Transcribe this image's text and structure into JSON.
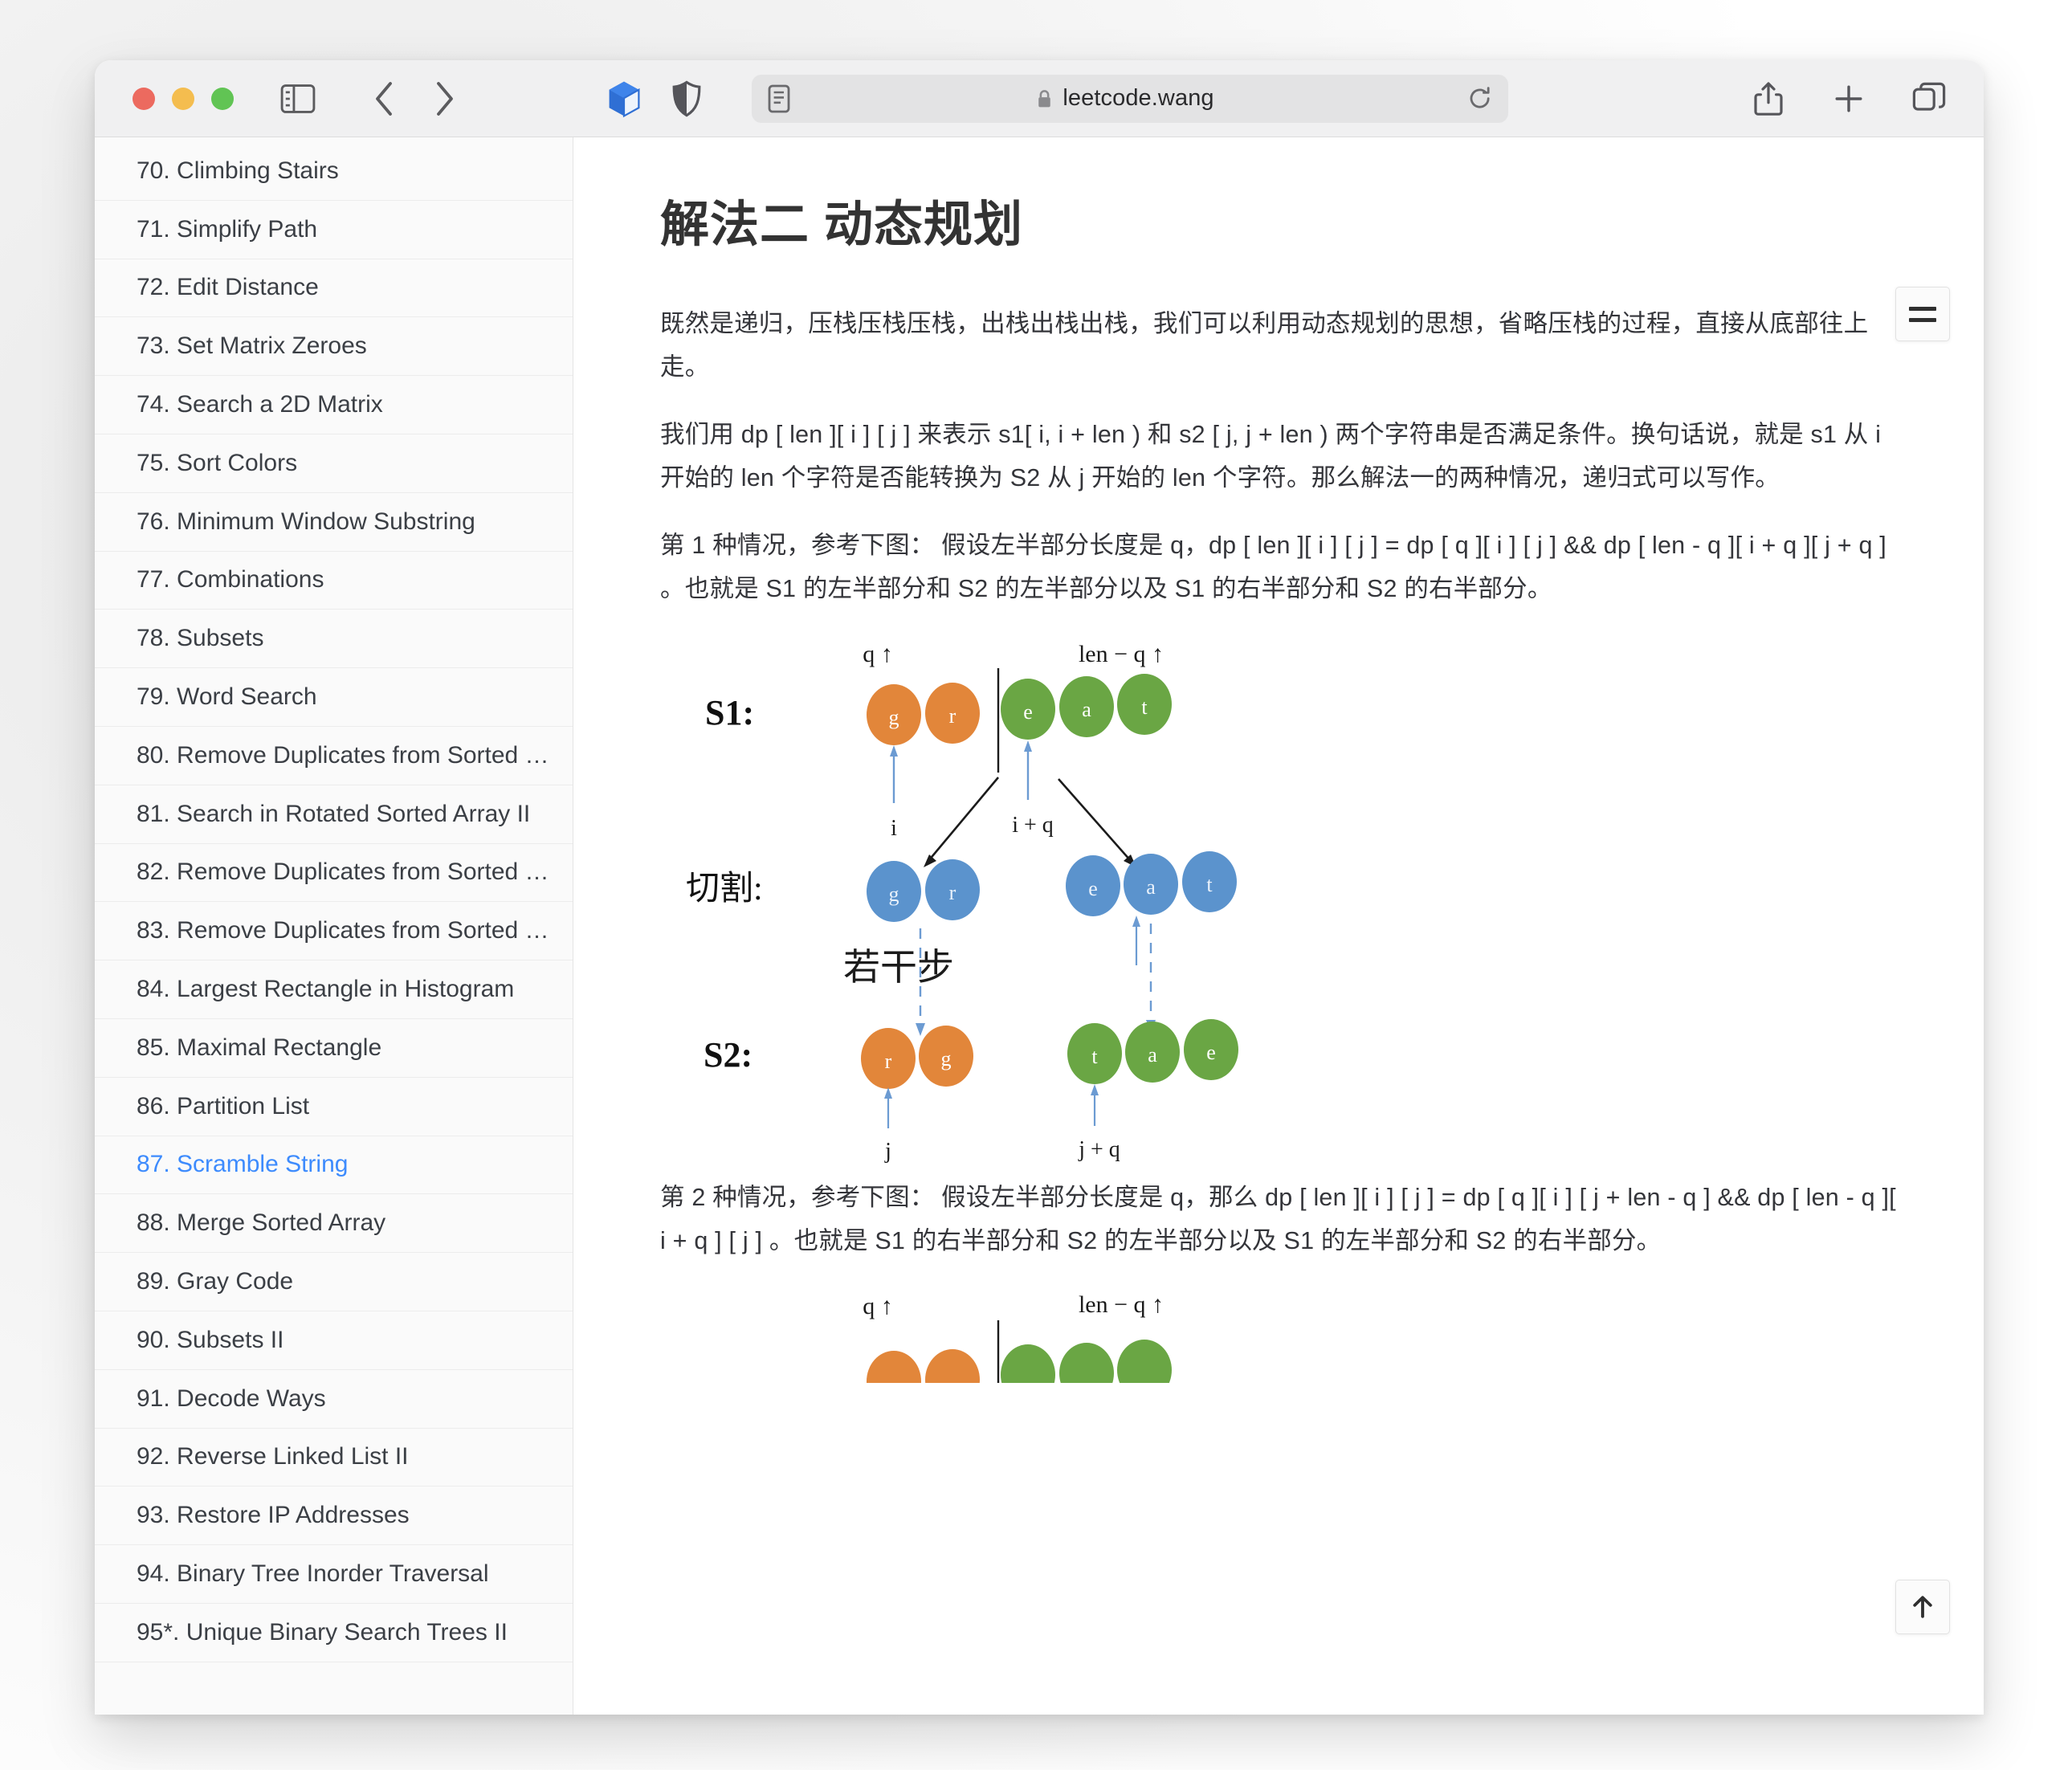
{
  "browser": {
    "url": "leetcode.wang",
    "icons": {
      "sidebar_toggle": "sidebar-icon",
      "back": "chevron-left-icon",
      "forward": "chevron-right-icon",
      "extension": "cube-icon",
      "shield": "shield-icon",
      "reader": "reader-view-icon",
      "lock": "lock-icon",
      "reload": "reload-icon",
      "share": "share-icon",
      "new_tab": "plus-icon",
      "tab_overview": "tab-overview-icon"
    }
  },
  "sidebar": {
    "items": [
      {
        "label": "70. Climbing Stairs",
        "active": false
      },
      {
        "label": "71. Simplify Path",
        "active": false
      },
      {
        "label": "72. Edit Distance",
        "active": false
      },
      {
        "label": "73. Set Matrix Zeroes",
        "active": false
      },
      {
        "label": "74. Search a 2D Matrix",
        "active": false
      },
      {
        "label": "75. Sort Colors",
        "active": false
      },
      {
        "label": "76. Minimum Window Substring",
        "active": false
      },
      {
        "label": "77. Combinations",
        "active": false
      },
      {
        "label": "78. Subsets",
        "active": false
      },
      {
        "label": "79. Word Search",
        "active": false
      },
      {
        "label": "80. Remove Duplicates from Sorted …",
        "active": false
      },
      {
        "label": "81. Search in Rotated Sorted Array II",
        "active": false
      },
      {
        "label": "82. Remove Duplicates from Sorted …",
        "active": false
      },
      {
        "label": "83. Remove Duplicates from Sorted …",
        "active": false
      },
      {
        "label": "84. Largest Rectangle in Histogram",
        "active": false
      },
      {
        "label": "85. Maximal Rectangle",
        "active": false
      },
      {
        "label": "86. Partition List",
        "active": false
      },
      {
        "label": "87. Scramble String",
        "active": true
      },
      {
        "label": "88. Merge Sorted Array",
        "active": false
      },
      {
        "label": "89. Gray Code",
        "active": false
      },
      {
        "label": "90. Subsets II",
        "active": false
      },
      {
        "label": "91. Decode Ways",
        "active": false
      },
      {
        "label": "92. Reverse Linked List II",
        "active": false
      },
      {
        "label": "93. Restore IP Addresses",
        "active": false
      },
      {
        "label": "94. Binary Tree Inorder Traversal",
        "active": false
      },
      {
        "label": "95*. Unique Binary Search Trees II",
        "active": false
      }
    ],
    "active_color": "#3d8bfd"
  },
  "article": {
    "title": "解法二 动态规划",
    "paragraphs": [
      "既然是递归，压栈压栈压栈，出栈出栈出栈，我们可以利用动态规划的思想，省略压栈的过程，直接从底部往上走。",
      "我们用 dp [ len ][ i ] [ j ] 来表示 s1[ i, i + len ) 和 s2 [ j, j + len ) 两个字符串是否满足条件。换句话说，就是 s1 从 i 开始的 len 个字符是否能转换为 S2 从 j 开始的 len 个字符。那么解法一的两种情况，递归式可以写作。",
      "第 1 种情况，参考下图： 假设左半部分长度是 q，dp [ len ][ i ] [ j ] = dp [ q ][ i ] [ j ] && dp [ len - q ][ i + q ][ j + q ] 。也就是 S1 的左半部分和 S2 的左半部分以及 S1 的右半部分和 S2 的右半部分。",
      "第 2 种情况，参考下图： 假设左半部分长度是 q，那么 dp [ len ][ i ] [ j ] = dp [ q ][ i ] [ j + len - q ] && dp [ len - q ][ i + q ] [ j ] 。也就是 S1 的右半部分和 S2 的左半部分以及 S1 的左半部分和 S2 的右半部分。"
    ]
  },
  "figure1": {
    "row_labels": {
      "s1": "S1:",
      "cut": "切割:",
      "s2": "S2:"
    },
    "top_labels": {
      "left": "q ↑",
      "right": "len − q ↑"
    },
    "index_labels": {
      "i": "i",
      "i_plus_q": "i + q",
      "j": "j",
      "j_plus_q": "j + q"
    },
    "steps_label": "若干步",
    "rows": {
      "s1": [
        {
          "letter": "g",
          "color": "#e2863a"
        },
        {
          "letter": "r",
          "color": "#e2863a"
        },
        {
          "letter": "e",
          "color": "#6aa644"
        },
        {
          "letter": "a",
          "color": "#6aa644"
        },
        {
          "letter": "t",
          "color": "#6aa644"
        }
      ],
      "cut": [
        {
          "letter": "g",
          "color": "#5b93cd"
        },
        {
          "letter": "r",
          "color": "#5b93cd"
        },
        {
          "letter": "e",
          "color": "#5b93cd"
        },
        {
          "letter": "a",
          "color": "#5b93cd"
        },
        {
          "letter": "t",
          "color": "#5b93cd"
        }
      ],
      "s2": [
        {
          "letter": "r",
          "color": "#e2863a"
        },
        {
          "letter": "g",
          "color": "#e2863a"
        },
        {
          "letter": "t",
          "color": "#6aa644"
        },
        {
          "letter": "a",
          "color": "#6aa644"
        },
        {
          "letter": "e",
          "color": "#6aa644"
        }
      ]
    }
  },
  "figure2": {
    "top_labels": {
      "left": "q ↑",
      "right": "len − q ↑"
    },
    "row": [
      {
        "letter": "",
        "color": "#e2863a"
      },
      {
        "letter": "",
        "color": "#e2863a"
      },
      {
        "letter": "",
        "color": "#6aa644"
      },
      {
        "letter": "",
        "color": "#6aa644"
      },
      {
        "letter": "",
        "color": "#6aa644"
      }
    ]
  },
  "buttons": {
    "toc": "toc-hamburger",
    "back_to_top": "back-to-top-arrow"
  }
}
